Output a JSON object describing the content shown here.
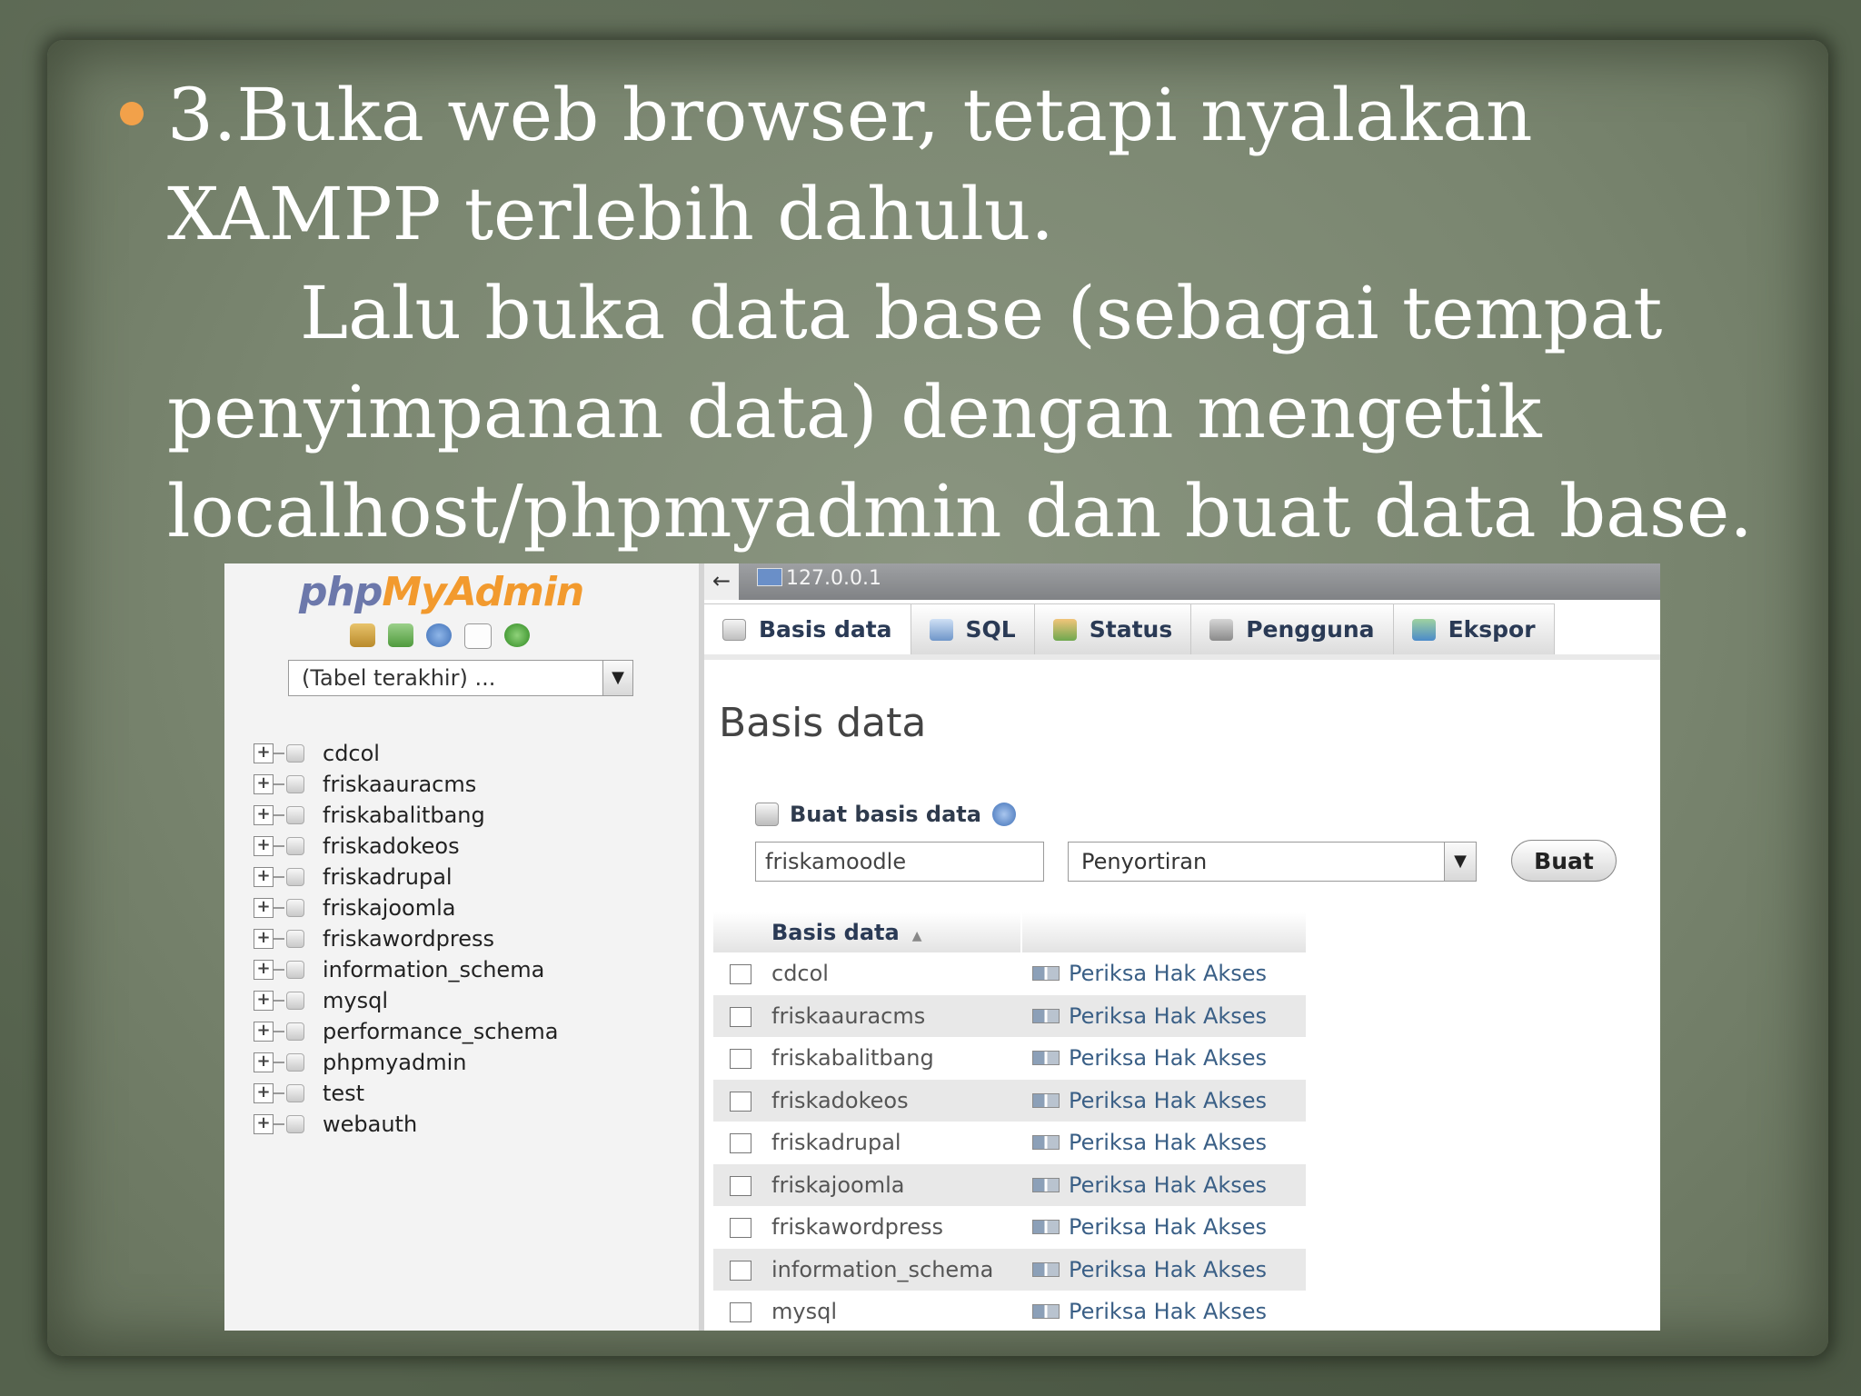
{
  "slide": {
    "bullet_lines": [
      "3.Buka web browser, tetapi nyalakan",
      "XAMPP terlebih dahulu.",
      "Lalu buka data base (sebagai tempat",
      "penyimpanan data) dengan mengetik",
      "localhost/phpmyadmin dan buat data base."
    ],
    "bullet_color": "#f2a14a"
  },
  "pma": {
    "logo": {
      "php": "php",
      "myadmin": "MyAdmin"
    },
    "nav_icons": [
      "home-icon",
      "sql-query-icon",
      "help-icon",
      "docs-icon",
      "reload-icon"
    ],
    "recent_tables": "(Tabel terakhir) ...",
    "databases_tree": [
      "cdcol",
      "friskaauracms",
      "friskabalitbang",
      "friskadokeos",
      "friskadrupal",
      "friskajoomla",
      "friskawordpress",
      "information_schema",
      "mysql",
      "performance_schema",
      "phpmyadmin",
      "test",
      "webauth"
    ],
    "breadcrumb": {
      "back": "←",
      "server": "127.0.0.1"
    },
    "tabs": [
      {
        "label": "Basis data",
        "icon": "database-icon"
      },
      {
        "label": "SQL",
        "icon": "sql-icon"
      },
      {
        "label": "Status",
        "icon": "status-icon"
      },
      {
        "label": "Pengguna",
        "icon": "users-icon"
      },
      {
        "label": "Ekspor",
        "icon": "export-icon"
      }
    ],
    "page_title": "Basis data",
    "create": {
      "label": "Buat basis data",
      "name_value": "friskamoodle",
      "collation": "Penyortiran",
      "button": "Buat"
    },
    "table": {
      "header": "Basis data",
      "sort_marker": "▲",
      "rows": [
        {
          "name": "cdcol",
          "privileges": "Periksa Hak Akses"
        },
        {
          "name": "friskaauracms",
          "privileges": "Periksa Hak Akses"
        },
        {
          "name": "friskabalitbang",
          "privileges": "Periksa Hak Akses"
        },
        {
          "name": "friskadokeos",
          "privileges": "Periksa Hak Akses"
        },
        {
          "name": "friskadrupal",
          "privileges": "Periksa Hak Akses"
        },
        {
          "name": "friskajoomla",
          "privileges": "Periksa Hak Akses"
        },
        {
          "name": "friskawordpress",
          "privileges": "Periksa Hak Akses"
        },
        {
          "name": "information_schema",
          "privileges": "Periksa Hak Akses"
        },
        {
          "name": "mysql",
          "privileges": "Periksa Hak Akses"
        }
      ]
    },
    "colors": {
      "logo_php": "#6c78ab",
      "logo_myadmin": "#f29a2e",
      "link": "#3a5f86"
    }
  }
}
